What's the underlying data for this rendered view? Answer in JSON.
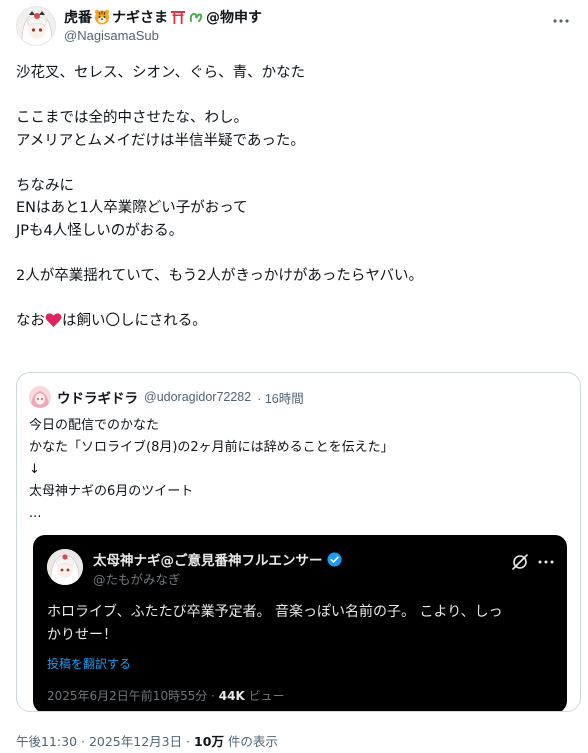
{
  "author": {
    "display_name": "虎番",
    "display_name_suffix": "ナギさま",
    "display_name_tail": "@物申す",
    "handle": "@NagisamaSub",
    "avatar_icon": "avatar-girl-white-hair"
  },
  "body": {
    "lines": [
      "沙花叉、セレス、シオン、ぐら、青、かなた",
      "",
      "ここまでは全的中させたな、わし。",
      "アメリアとムメイだけは半信半疑であった。",
      "",
      "ちなみに",
      "ENはあと1人卒業際どい子がおって",
      "JPも4人怪しいのがおる。",
      "",
      "2人が卒業揺れていて、もう2人がきっかけがあったらヤバい。",
      ""
    ],
    "last_line_prefix": "なお",
    "last_line_suffix": "は飼い〇しにされる。"
  },
  "quote": {
    "name": "ウドラギドラ",
    "handle": "@udoragidor72282",
    "time": "· 16時間",
    "lines": [
      "今日の配信でのかなた",
      "かなた「ソロライブ(8月)の2ヶ月前には辞めることを伝えた」",
      "↓",
      "太母神ナギの6月のツイート",
      "..."
    ],
    "embedded": {
      "name": "太母神ナギ@ご意見番神フルエンサー",
      "handle": "@たもがみなぎ",
      "text_lines": [
        "ホロライブ、ふたたび卒業予定者。 音楽っぽい名前の子。 こより、しっ",
        "かりせー！"
      ],
      "translate_link": "投稿を翻訳する",
      "date": "2025年6月2日午前10時55分 · ",
      "views_count": "44K",
      "views_label": " ビュー"
    }
  },
  "footer": {
    "time": "午後11:30 · 2025年12月3日 · ",
    "views_count": "10万",
    "views_label": " 件の表示"
  },
  "colors": {
    "text": "#0f1419",
    "secondary": "#536471",
    "link": "#1d9bf0",
    "heart": "#e0245e",
    "verified": "#1d9bf0"
  }
}
